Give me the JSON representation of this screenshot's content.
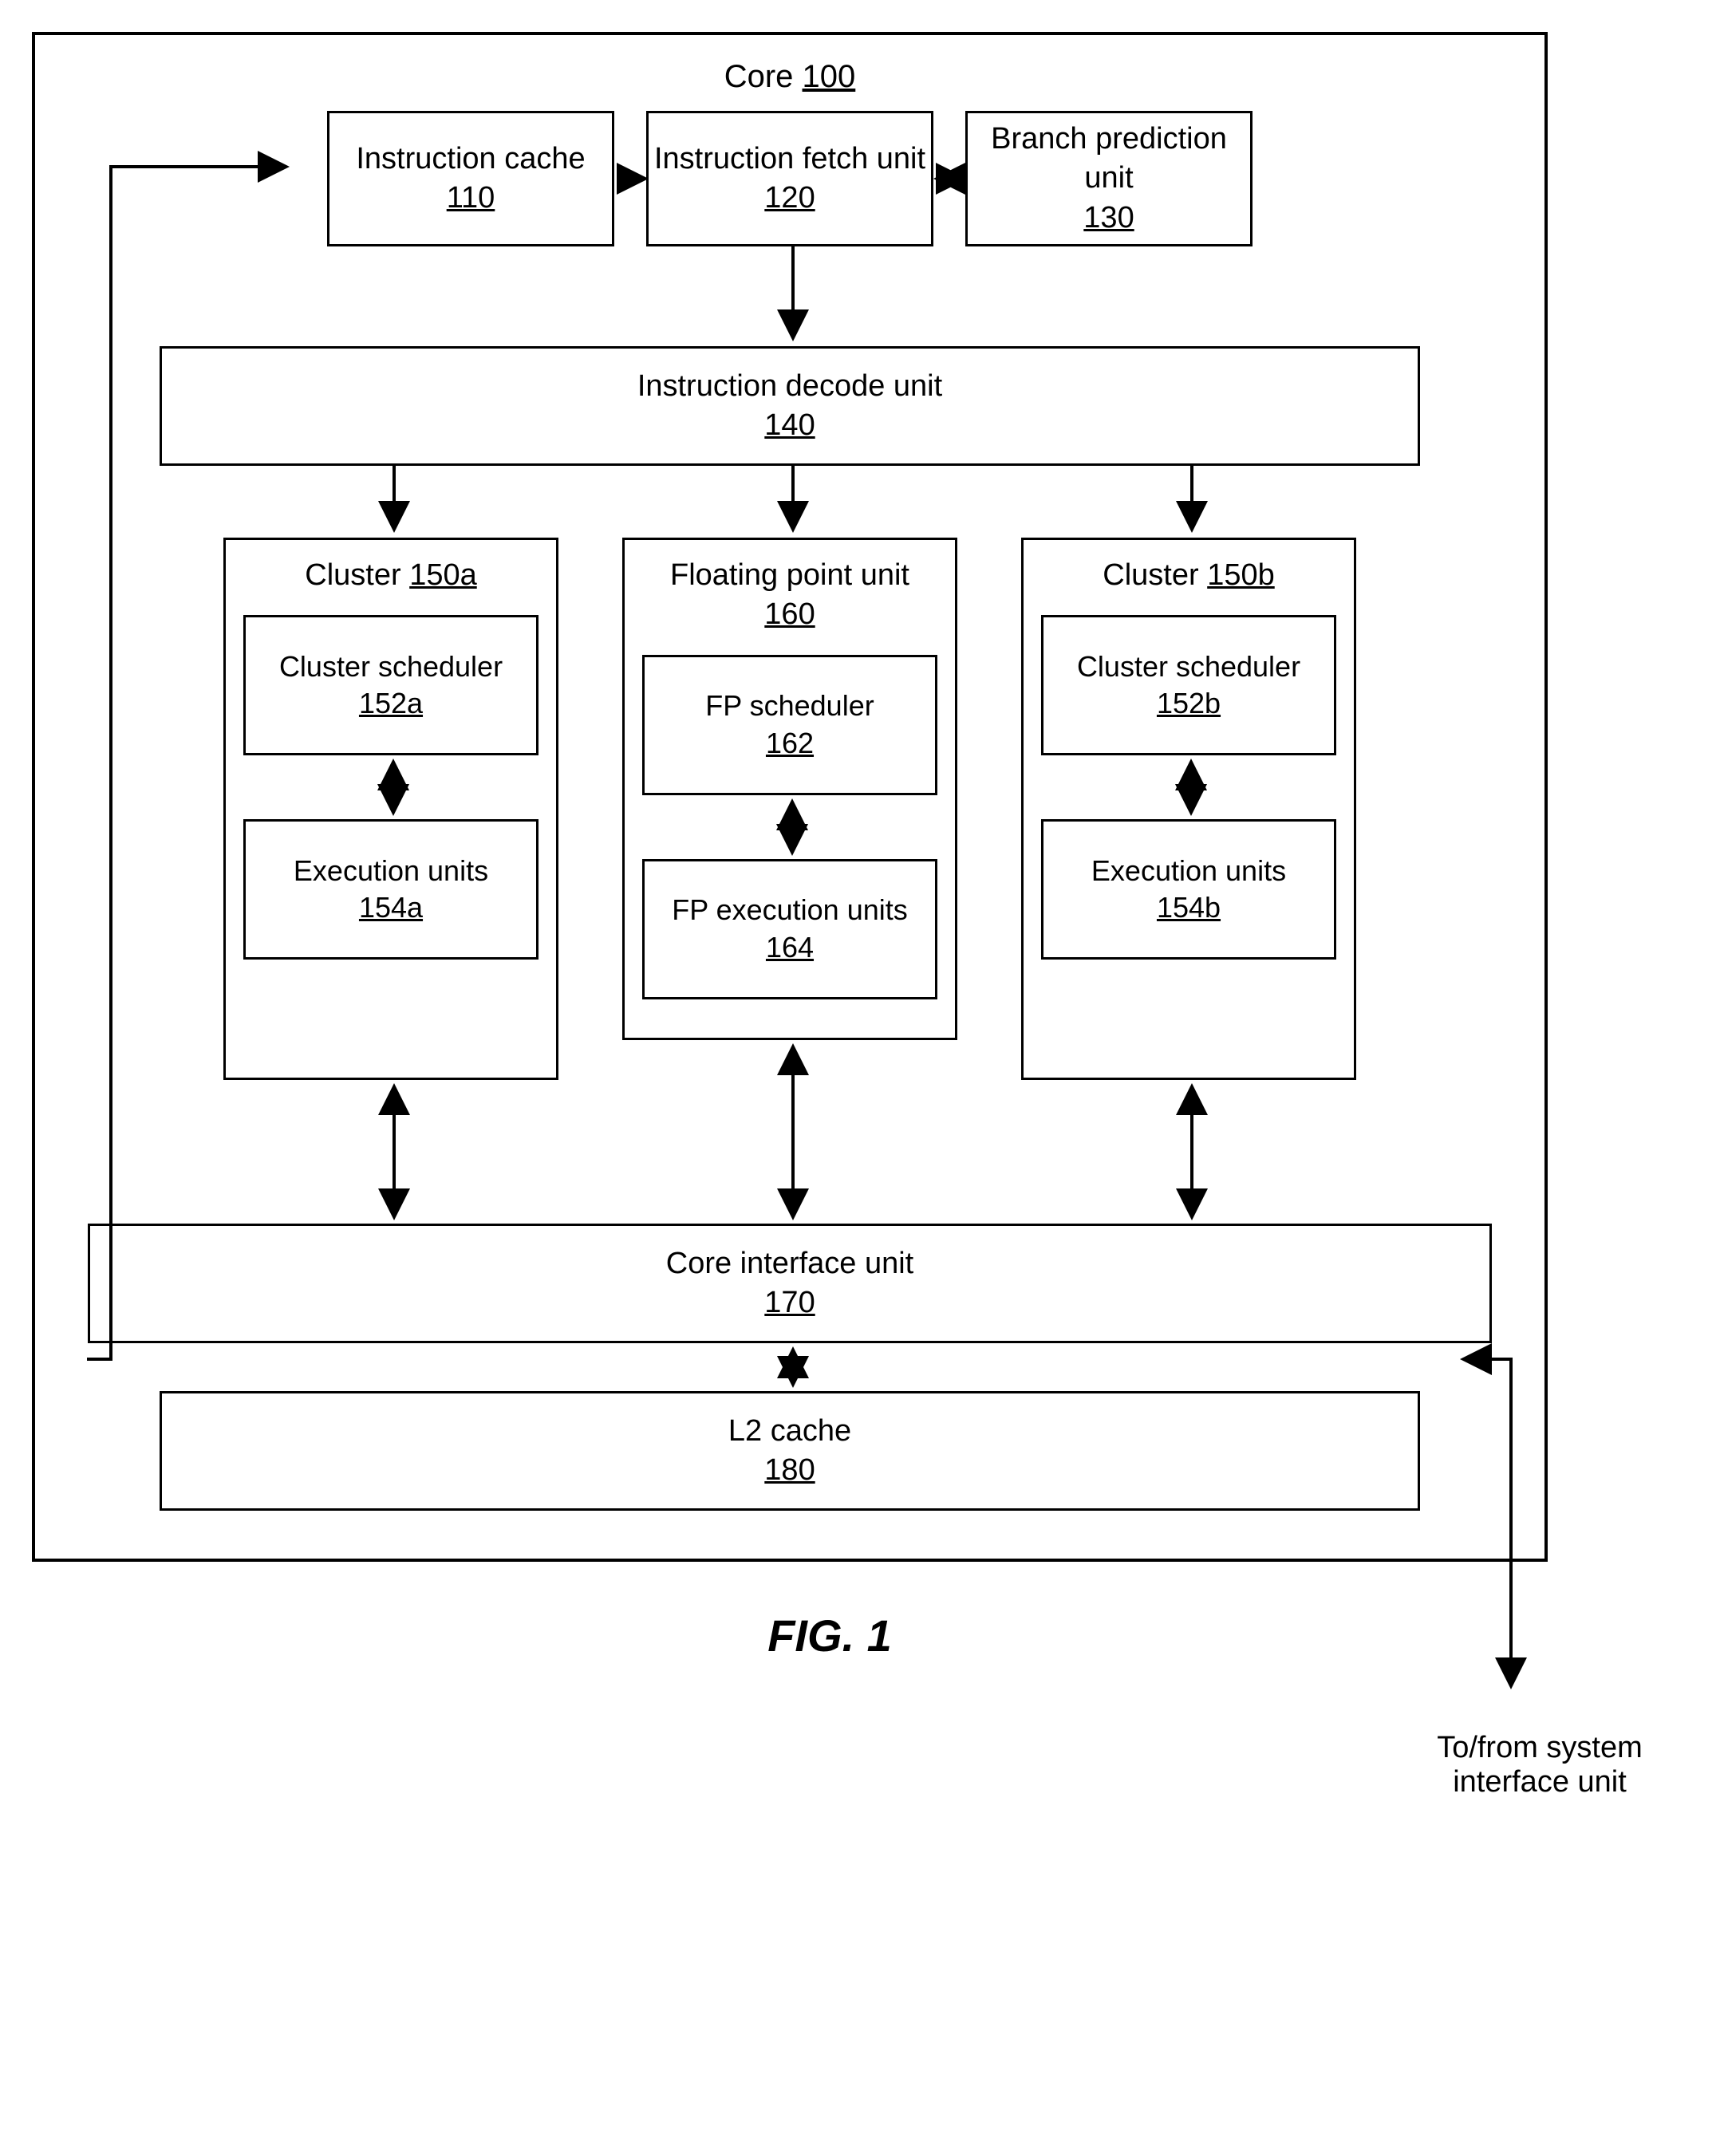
{
  "core": {
    "title": "Core",
    "num": "100"
  },
  "icache": {
    "label": "Instruction cache",
    "num": "110"
  },
  "ifetch": {
    "label": "Instruction fetch unit",
    "num": "120"
  },
  "bpred": {
    "label": "Branch prediction unit",
    "num": "130"
  },
  "decode": {
    "label": "Instruction decode unit",
    "num": "140"
  },
  "clusterA": {
    "label": "Cluster",
    "num": "150a",
    "sched": {
      "label": "Cluster scheduler",
      "num": "152a"
    },
    "exec": {
      "label": "Execution units",
      "num": "154a"
    }
  },
  "fp": {
    "label": "Floating point unit",
    "num": "160",
    "sched": {
      "label": "FP scheduler",
      "num": "162"
    },
    "exec": {
      "label": "FP execution units",
      "num": "164"
    }
  },
  "clusterB": {
    "label": "Cluster",
    "num": "150b",
    "sched": {
      "label": "Cluster scheduler",
      "num": "152b"
    },
    "exec": {
      "label": "Execution units",
      "num": "154b"
    }
  },
  "ciu": {
    "label": "Core interface unit",
    "num": "170"
  },
  "l2": {
    "label": "L2 cache",
    "num": "180"
  },
  "figure": "FIG. 1",
  "ext": "To/from system interface unit"
}
